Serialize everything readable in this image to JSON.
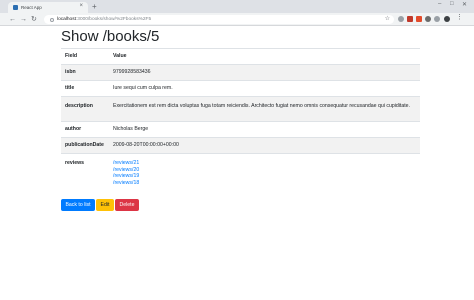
{
  "browser": {
    "tab_title": "React App",
    "tab_close": "×",
    "new_tab": "+",
    "url_host": "localhost",
    "url_path": ":3000/books/show/%2Fbooks%2F5",
    "nav": {
      "back": "←",
      "forward": "→",
      "reload": "↻"
    },
    "star": "☆",
    "window_controls": {
      "minimize": "–",
      "maximize": "□",
      "close": "✕"
    },
    "extension_colors": [
      "#9aa0a6",
      "#c0392b",
      "#e34b2b",
      "#6b6b6b",
      "#2c2c2c"
    ]
  },
  "page": {
    "title": "Show /books/5",
    "table": {
      "header_field": "Field",
      "header_value": "Value",
      "rows": {
        "isbn": {
          "label": "isbn",
          "value": "9799928583436"
        },
        "title": {
          "label": "title",
          "value": "Iure sequi cum culpa rem."
        },
        "description": {
          "label": "description",
          "value": "Exercitationem est rem dicta voluptas fuga totam reiciendis. Architecto fugiat nemo omnis consequatur recusandae qui cupiditate."
        },
        "author": {
          "label": "author",
          "value": "Nicholas Berge"
        },
        "publicationDate": {
          "label": "publicationDate",
          "value": "2009-08-20T00:00:00+00:00"
        },
        "reviews": {
          "label": "reviews",
          "links": [
            "/reviews/21",
            "/reviews/20",
            "/reviews/19",
            "/reviews/18"
          ]
        }
      }
    },
    "actions": {
      "back": "Back to list",
      "edit": "Edit",
      "delete": "Delete"
    }
  }
}
